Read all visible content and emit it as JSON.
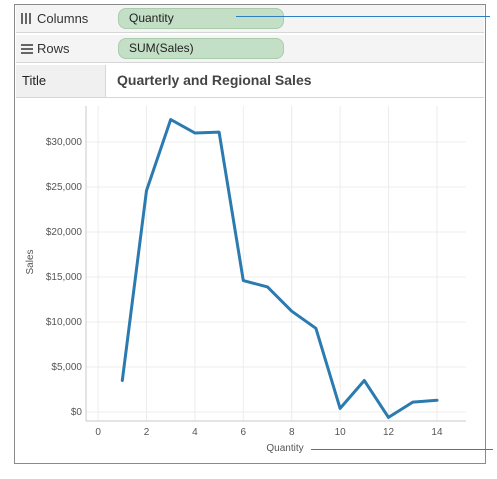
{
  "shelves": {
    "columns": {
      "label": "Columns",
      "pill": "Quantity",
      "icon": "columns-icon"
    },
    "rows": {
      "label": "Rows",
      "pill": "SUM(Sales)",
      "icon": "rows-icon"
    }
  },
  "title_shelf": {
    "label": "Title",
    "text": "Quarterly and Regional Sales"
  },
  "colors": {
    "line": "#2b7bb0",
    "pill": "#c3dfc6",
    "annotation": "#2e7fc1"
  },
  "chart_data": {
    "type": "line",
    "xlabel": "Quantity",
    "ylabel": "Sales",
    "x_ticks": [
      "0",
      "2",
      "4",
      "6",
      "8",
      "10",
      "12",
      "14"
    ],
    "y_ticks": [
      "$0",
      "$5,000",
      "$10,000",
      "$15,000",
      "$20,000",
      "$25,000",
      "$30,000"
    ],
    "xlim": [
      -0.5,
      15.2
    ],
    "ylim": [
      -1000,
      34000
    ],
    "grid": true,
    "x": [
      1,
      2,
      3,
      4,
      5,
      6,
      7,
      8,
      9,
      10,
      11,
      12,
      13,
      14
    ],
    "values": [
      3500,
      24600,
      32500,
      31000,
      31100,
      14600,
      13900,
      11200,
      9300,
      400,
      3500,
      -600,
      1100,
      1300
    ]
  }
}
